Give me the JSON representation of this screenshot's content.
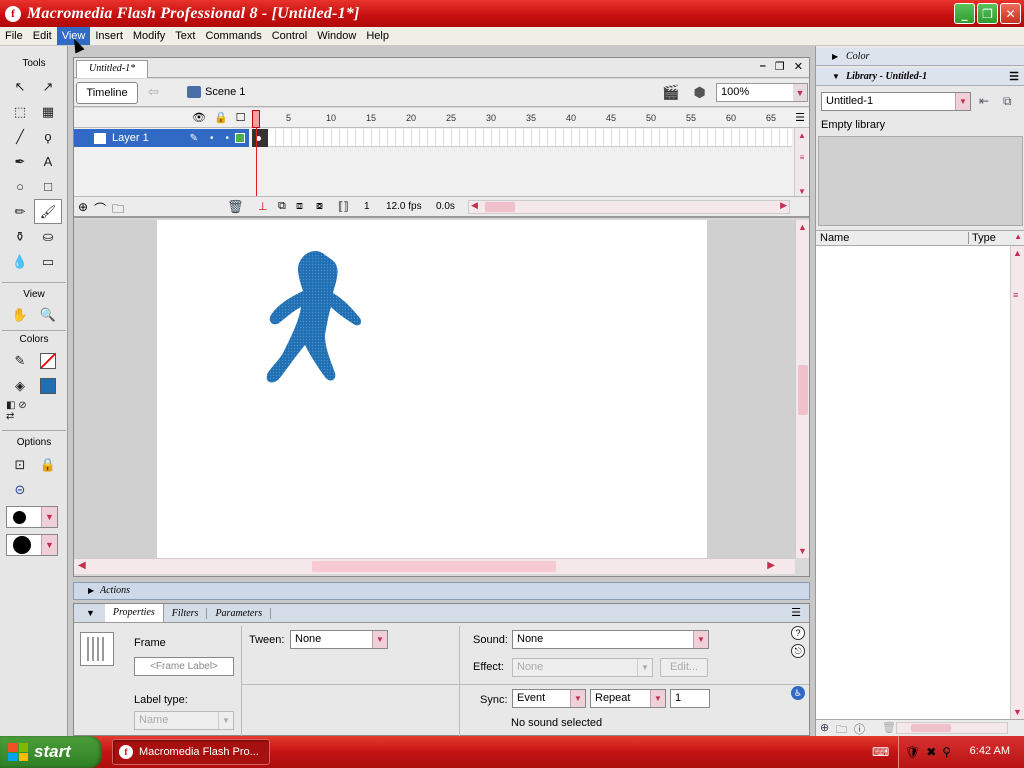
{
  "window": {
    "title": "Macromedia Flash Professional 8 - [Untitled-1*]",
    "minimize": "_",
    "maximize": "❐",
    "close": "✕"
  },
  "menubar": [
    "File",
    "Edit",
    "View",
    "Insert",
    "Modify",
    "Text",
    "Commands",
    "Control",
    "Window",
    "Help"
  ],
  "menubar_active": "View",
  "tools": {
    "sections": {
      "tools": "Tools",
      "view": "View",
      "colors": "Colors",
      "options": "Options"
    },
    "items": [
      {
        "name": "selection-tool-icon",
        "glyph": "↖"
      },
      {
        "name": "subselection-tool-icon",
        "glyph": "↗"
      },
      {
        "name": "free-transform-tool-icon",
        "glyph": "⬚"
      },
      {
        "name": "gradient-transform-tool-icon",
        "glyph": "▦"
      },
      {
        "name": "line-tool-icon",
        "glyph": "╱"
      },
      {
        "name": "lasso-tool-icon",
        "glyph": "ϙ"
      },
      {
        "name": "pen-tool-icon",
        "glyph": "✒"
      },
      {
        "name": "text-tool-icon",
        "glyph": "A"
      },
      {
        "name": "oval-tool-icon",
        "glyph": "○"
      },
      {
        "name": "rectangle-tool-icon",
        "glyph": "□"
      },
      {
        "name": "pencil-tool-icon",
        "glyph": "✏"
      },
      {
        "name": "brush-tool-icon",
        "glyph": "🖌"
      },
      {
        "name": "ink-bottle-tool-icon",
        "glyph": "⚱"
      },
      {
        "name": "paint-bucket-tool-icon",
        "glyph": "⛀"
      },
      {
        "name": "eyedropper-tool-icon",
        "glyph": "💧"
      },
      {
        "name": "eraser-tool-icon",
        "glyph": "▭"
      }
    ],
    "view_items": [
      {
        "name": "hand-tool-icon",
        "glyph": "✋"
      },
      {
        "name": "zoom-tool-icon",
        "glyph": "🔍"
      }
    ]
  },
  "document": {
    "tab": "Untitled-1*",
    "timeline_button": "Timeline",
    "scene": "Scene 1",
    "zoom": "100%",
    "layer_name": "Layer 1",
    "ruler_numbers": [
      "1",
      "5",
      "10",
      "15",
      "20",
      "25",
      "30",
      "35",
      "40",
      "45",
      "50",
      "55",
      "60",
      "65"
    ],
    "current_frame": "1",
    "fps": "12.0 fps",
    "elapsed": "0.0s"
  },
  "colors": {
    "figure_fill": "#1f6fb2",
    "selection": "#316ac5",
    "title_red": "#c40f0f",
    "stage": "#ffffff"
  },
  "actions_panel": {
    "title": "Actions"
  },
  "properties": {
    "tabs": [
      "Properties",
      "Filters",
      "Parameters"
    ],
    "frame_label": "Frame",
    "frame_label_placeholder": "<Frame Label>",
    "label_type_label": "Label type:",
    "label_type_value": "Name",
    "tween_label": "Tween:",
    "tween_value": "None",
    "sound_label": "Sound:",
    "sound_value": "None",
    "effect_label": "Effect:",
    "effect_value": "None",
    "edit_button": "Edit...",
    "sync_label": "Sync:",
    "sync_value": "Event",
    "repeat_value": "Repeat",
    "repeat_count": "1",
    "sound_status": "No sound selected"
  },
  "right_panels": {
    "color_title": "Color",
    "library_title": "Library - Untitled-1",
    "library_doc": "Untitled-1",
    "empty_text": "Empty library",
    "col_name": "Name",
    "col_type": "Type"
  },
  "taskbar": {
    "start": "start",
    "task": "Macromedia Flash Pro...",
    "clock": "6:42 AM"
  }
}
